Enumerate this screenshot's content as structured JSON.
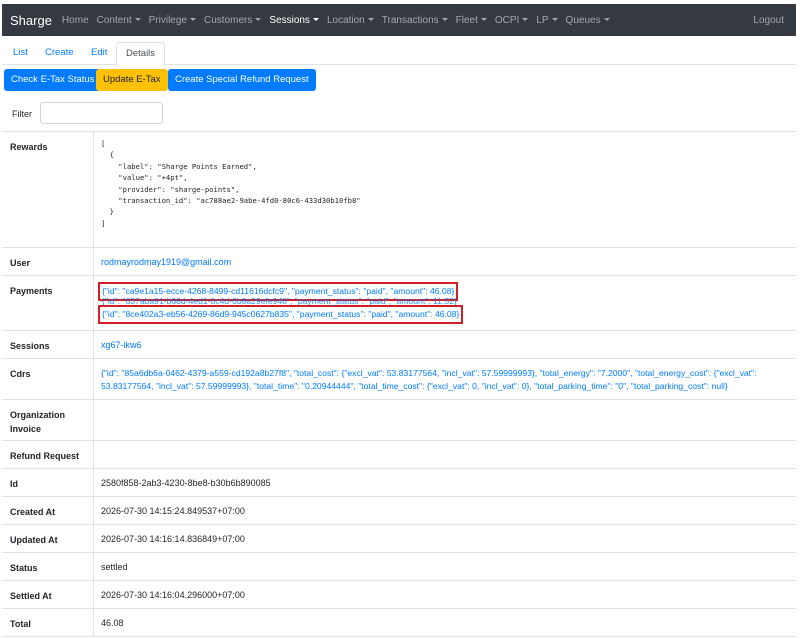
{
  "navbar": {
    "brand": "Sharge",
    "items": [
      {
        "label": "Home",
        "dropdown": false,
        "active": false
      },
      {
        "label": "Content",
        "dropdown": true,
        "active": false
      },
      {
        "label": "Privilege",
        "dropdown": true,
        "active": false
      },
      {
        "label": "Customers",
        "dropdown": true,
        "active": false
      },
      {
        "label": "Sessions",
        "dropdown": true,
        "active": true
      },
      {
        "label": "Location",
        "dropdown": true,
        "active": false
      },
      {
        "label": "Transactions",
        "dropdown": true,
        "active": false
      },
      {
        "label": "Fleet",
        "dropdown": true,
        "active": false
      },
      {
        "label": "OCPI",
        "dropdown": true,
        "active": false
      },
      {
        "label": "LP",
        "dropdown": true,
        "active": false
      },
      {
        "label": "Queues",
        "dropdown": true,
        "active": false
      }
    ],
    "logout": "Logout"
  },
  "tabs": {
    "list": "List",
    "create": "Create",
    "edit": "Edit",
    "details": "Details"
  },
  "actions": {
    "check_etax": "Check E-Tax Status",
    "update_etax": "Update E-Tax",
    "create_refund": "Create Special Refund Request"
  },
  "filter": {
    "label": "Filter",
    "value": ""
  },
  "details": {
    "rewards_label": "Rewards",
    "rewards_json": "[\n  {\n    \"label\": \"Sharge Points Earned\",\n    \"value\": \"+4pt\",\n    \"provider\": \"sharge-points\",\n    \"transaction_id\": \"ac788ae2-9abe-4fd0-80c6-433d30b10fb8\"\n  }\n]",
    "user_label": "User",
    "user_value": "rodmayrodmay1919@gmail.com",
    "payments_label": "Payments",
    "payment_1": "{\"id\": \"ca9e1a15-ecce-4268-8499-cd11616dcfc9\", \"payment_status\": \"paid\", \"amount\": 46.08}",
    "payment_2": "{\"id\": \"637aba91-b68d-4ed1-8c4d-6b8a29efe948\", \"payment_status\": \"paid\", \"amount\": 11.52}",
    "payment_3": "{\"id\": \"8ce402a3-eb56-4269-86d9-945c0627b835\", \"payment_status\": \"paid\", \"amount\": 46.08}",
    "sessions_label": "Sessions",
    "sessions_value": "xg67-ikw6",
    "cdrs_label": "Cdrs",
    "cdrs_value": "{\"id\": \"85a6db6a-0462-4379-a559-cd192a8b27f8\", \"total_cost\": {\"excl_vat\": 53.83177564, \"incl_vat\": 57.59999993}, \"total_energy\": \"7.2000\", \"total_energy_cost\": {\"excl_vat\": 53.83177564, \"incl_vat\": 57.59999993}, \"total_time\": \"0.20944444\", \"total_time_cost\": {\"excl_vat\": 0, \"incl_vat\": 0}, \"total_parking_time\": \"0\", \"total_parking_cost\": null}",
    "org_invoice_label": "Organization Invoice",
    "refund_label": "Refund Request",
    "id_label": "Id",
    "id_value": "2580f858-2ab3-4230-8be8-b30b6b890085",
    "created_label": "Created At",
    "created_value": "2026-07-30 14:15:24.849537+07:00",
    "updated_label": "Updated At",
    "updated_value": "2026-07-30 14:16:14.836849+07:00",
    "status_label": "Status",
    "status_value": "settled",
    "settled_label": "Settled At",
    "settled_value": "2026-07-30 14:16:04.296000+07:00",
    "total_label": "Total",
    "total_value": "46.08"
  },
  "colors": {
    "navbar": "#343a40",
    "primary": "#007bff",
    "warning": "#ffc107",
    "highlight": "#d01f25"
  }
}
